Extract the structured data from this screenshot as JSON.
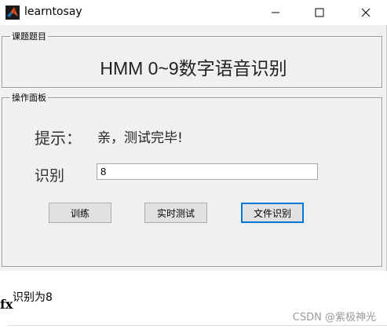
{
  "window": {
    "title": "learntosay",
    "controls": {
      "minimize": "minimize-icon",
      "maximize": "maximize-icon",
      "close": "close-icon"
    }
  },
  "topic_panel": {
    "legend": "课题题目",
    "heading": "HMM 0~9数字语音识别"
  },
  "ops_panel": {
    "legend": "操作面板",
    "hint_label": "提示：",
    "hint_value": "亲，测试完毕!",
    "recog_label": "识别",
    "recog_value": "8",
    "buttons": {
      "train": "训练",
      "live_test": "实时测试",
      "file_recog": "文件识别"
    }
  },
  "console": {
    "output": "识别为8",
    "edge_glyph": "fx"
  },
  "watermark": "CSDN @紫极神光",
  "colors": {
    "focus_border": "#0078d7",
    "panel_bg": "#f0f0f0"
  }
}
